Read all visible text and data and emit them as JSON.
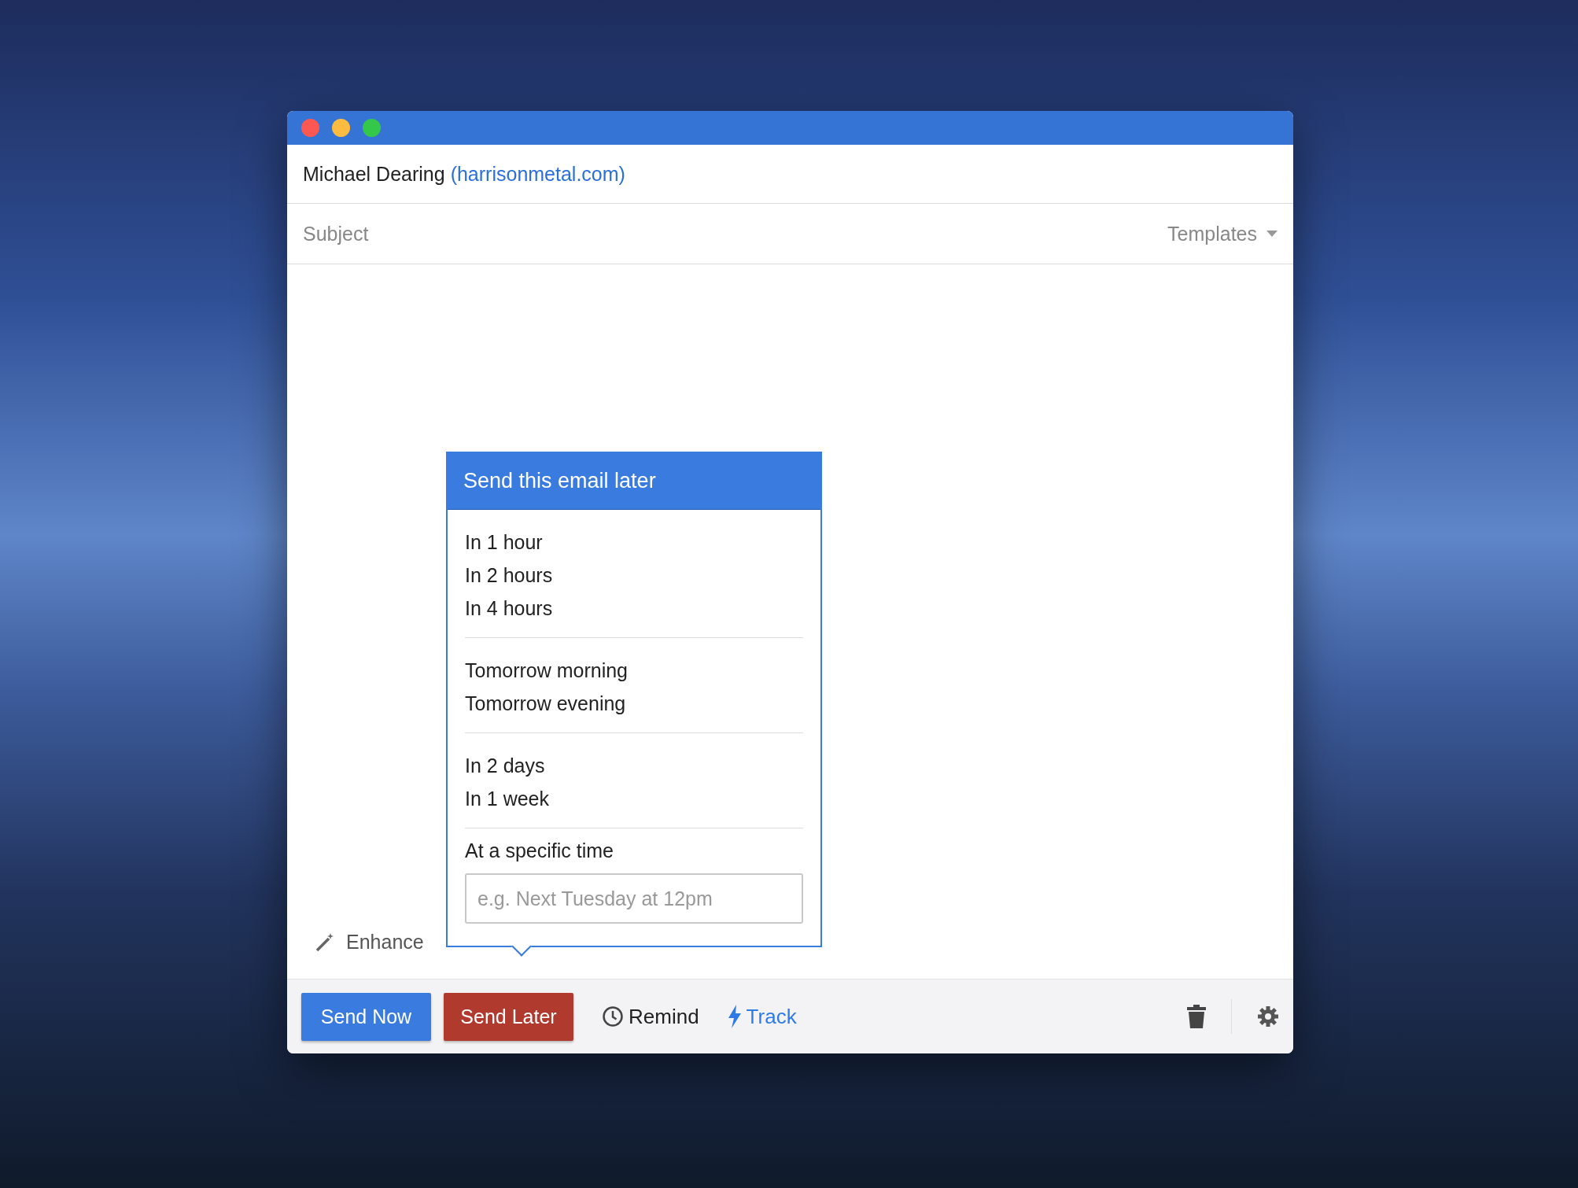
{
  "to": {
    "name": "Michael Dearing",
    "domain": "(harrisonmetal.com)"
  },
  "subject": {
    "placeholder": "Subject"
  },
  "templates": {
    "label": "Templates"
  },
  "enhance": {
    "label": "Enhance"
  },
  "send_later_menu": {
    "title": "Send this email later",
    "groups": [
      {
        "items": [
          "In 1 hour",
          "In 2 hours",
          "In 4 hours"
        ]
      },
      {
        "items": [
          "Tomorrow morning",
          "Tomorrow evening"
        ]
      },
      {
        "items": [
          "In 2 days",
          "In 1 week"
        ]
      }
    ],
    "specific_time": {
      "label": "At a specific time",
      "placeholder": "e.g. Next Tuesday at 12pm"
    }
  },
  "footer": {
    "buttons": [
      {
        "kind": "primary",
        "label": "Send Now"
      },
      {
        "kind": "danger",
        "label": "Send Later"
      },
      {
        "kind": "remind",
        "label": "Remind"
      },
      {
        "kind": "track",
        "label": "Track"
      }
    ]
  }
}
